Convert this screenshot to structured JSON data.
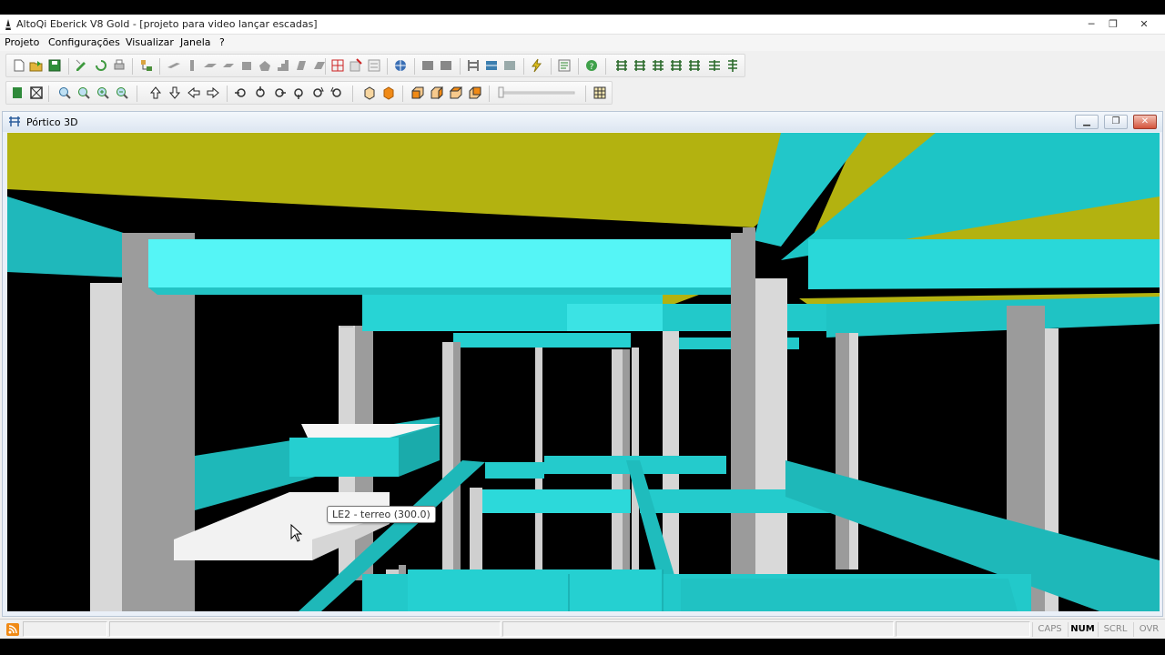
{
  "window": {
    "title": "AltoQi Eberick V8 Gold - [projeto para video lançar escadas]",
    "controls": {
      "minimize": "─",
      "restore": "❐",
      "close": "✕"
    }
  },
  "menu": [
    "Projeto",
    "Configurações",
    "Visualizar",
    "Janela",
    "?"
  ],
  "toolbar_icons": {
    "row1": [
      "new-file-icon",
      "open-folder-icon",
      "save-icon",
      "check-edit-icon",
      "check-refresh-icon",
      "print-icon",
      "tree-icon",
      "beam-shape-icon",
      "column-shape-icon",
      "slab-shape-icon",
      "footing-shape-icon",
      "block-shape-icon",
      "pile-shape-icon",
      "stair-shape-icon",
      "wall-shape-icon",
      "load-shape-icon",
      "grid-red-icon",
      "grid-select-icon",
      "grid-magnet-icon",
      "globe-icon",
      "table-icon",
      "chart-icon",
      "frame-icon",
      "cube-icon",
      "cloud-icon",
      "lightning-icon",
      "report-icon",
      "help-icon",
      "floor-stack-1-icon",
      "floor-stack-2-icon",
      "floor-stack-3-icon",
      "floor-stack-4-icon",
      "floor-stack-5-icon",
      "floor-stack-6-icon"
    ],
    "row2": [
      "export-icon",
      "fit-window-icon",
      "zoom-icon",
      "zoom-window-icon",
      "zoom-in-icon",
      "zoom-out-icon",
      "arrow-up-icon",
      "arrow-down-icon",
      "arrow-left-icon",
      "arrow-right-icon",
      "rotate-left-icon",
      "rotate-up-icon",
      "rotate-right-icon",
      "rotate-down-icon",
      "rotate-cw-icon",
      "rotate-ccw-icon",
      "cube-wire-icon",
      "cube-solid-icon",
      "view-front-icon",
      "view-back-icon",
      "view-left-icon",
      "view-right-icon",
      "slider-track",
      "grid-table-icon"
    ]
  },
  "child_window": {
    "title": "Pórtico 3D",
    "controls": {
      "minimize": "▁",
      "restore": "❐",
      "close": "✕"
    }
  },
  "tooltip": "LE2 - terreo (300.0)",
  "colors": {
    "slab": "#b3b210",
    "beam": "#23cfd0",
    "beam_light": "#55f5f6",
    "column": "#9b9b9b",
    "column_light": "#d9d9d9",
    "stair": "#f2f2f2",
    "background": "#000000"
  },
  "status": {
    "indicators": [
      {
        "label": "CAPS",
        "active": false
      },
      {
        "label": "NUM",
        "active": true
      },
      {
        "label": "SCRL",
        "active": false
      },
      {
        "label": "OVR",
        "active": false
      }
    ]
  }
}
